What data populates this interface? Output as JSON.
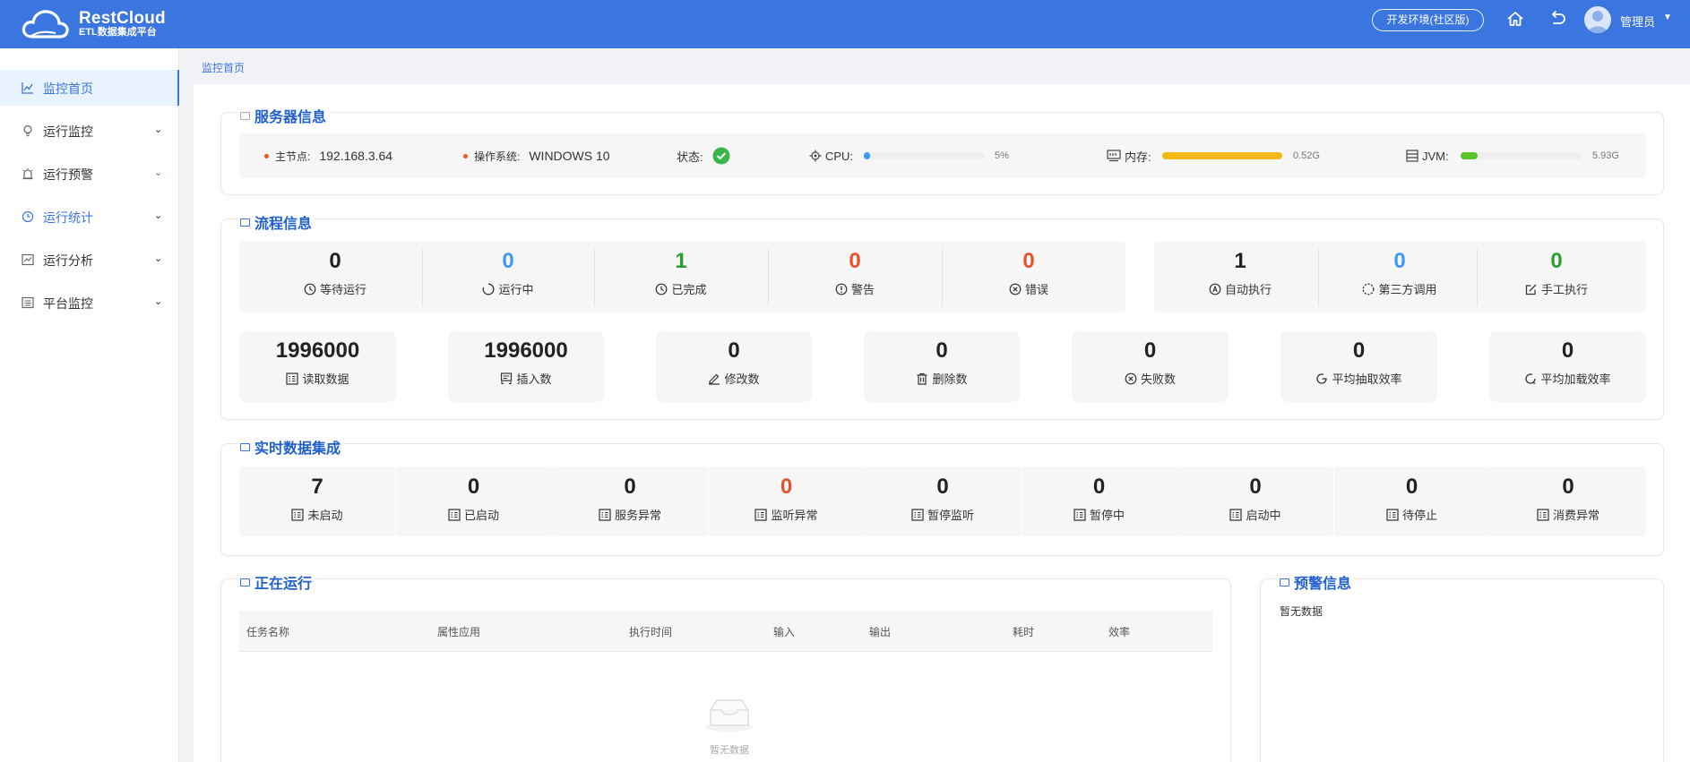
{
  "header": {
    "logo_name": "RestCloud",
    "logo_sub": "ETL数据集成平台",
    "env_label": "开发环境(社区版)",
    "user_name": "管理员"
  },
  "sidebar": {
    "items": [
      {
        "label": "监控首页",
        "icon": "chart-line-icon",
        "active": true
      },
      {
        "label": "运行监控",
        "icon": "bulb-icon"
      },
      {
        "label": "运行预警",
        "icon": "alarm-icon"
      },
      {
        "label": "运行统计",
        "icon": "clock-icon"
      },
      {
        "label": "运行分析",
        "icon": "analysis-icon"
      },
      {
        "label": "平台监控",
        "icon": "monitor-icon"
      }
    ]
  },
  "breadcrumb": "监控首页",
  "server": {
    "title": "服务器信息",
    "master_label": "主节点:",
    "master_value": "192.168.3.64",
    "os_label": "操作系统:",
    "os_value": "WINDOWS 10",
    "status_label": "状态:",
    "cpu_label": "CPU:",
    "cpu_value": "5%",
    "cpu_fraction": 0.05,
    "mem_label": "内存:",
    "mem_value": "0.52G",
    "mem_fraction": 1.0,
    "jvm_label": "JVM:",
    "jvm_value": "5.93G",
    "jvm_fraction": 0.14,
    "colors": {
      "cpu": "#3d9af5",
      "mem": "#f5b915",
      "jvm": "#58c62a"
    }
  },
  "flow": {
    "title": "流程信息",
    "status": [
      {
        "value": "0",
        "label": "等待运行",
        "icon": "clock-icon"
      },
      {
        "value": "0",
        "label": "运行中",
        "icon": "loading-icon"
      },
      {
        "value": "1",
        "label": "已完成",
        "icon": "clock-icon"
      },
      {
        "value": "0",
        "label": "警告",
        "icon": "warning-icon"
      },
      {
        "value": "0",
        "label": "错误",
        "icon": "error-icon"
      }
    ],
    "modes": [
      {
        "value": "1",
        "label": "自动执行",
        "icon": "auto-icon"
      },
      {
        "value": "0",
        "label": "第三方调用",
        "icon": "spinner-icon"
      },
      {
        "value": "0",
        "label": "手工执行",
        "icon": "edit-icon"
      }
    ],
    "cards": [
      {
        "value": "1996000",
        "label": "读取数据",
        "icon": "list-icon"
      },
      {
        "value": "1996000",
        "label": "插入数",
        "icon": "insert-icon"
      },
      {
        "value": "0",
        "label": "修改数",
        "icon": "pen-icon"
      },
      {
        "value": "0",
        "label": "删除数",
        "icon": "trash-icon"
      },
      {
        "value": "0",
        "label": "失败数",
        "icon": "error-icon"
      },
      {
        "value": "0",
        "label": "平均抽取效率",
        "icon": "refresh-icon"
      },
      {
        "value": "0",
        "label": "平均加载效率",
        "icon": "refresh-icon"
      }
    ]
  },
  "realtime": {
    "title": "实时数据集成",
    "items": [
      {
        "value": "7",
        "label": "未启动"
      },
      {
        "value": "0",
        "label": "已启动"
      },
      {
        "value": "0",
        "label": "服务异常"
      },
      {
        "value": "0",
        "label": "监听异常"
      },
      {
        "value": "0",
        "label": "暂停监听"
      },
      {
        "value": "0",
        "label": "暂停中"
      },
      {
        "value": "0",
        "label": "启动中"
      },
      {
        "value": "0",
        "label": "待停止"
      },
      {
        "value": "0",
        "label": "消费异常"
      }
    ]
  },
  "running": {
    "title": "正在运行",
    "columns": [
      "任务名称",
      "属性应用",
      "执行时间",
      "输入",
      "输出",
      "耗时",
      "效率"
    ],
    "empty_text": "暂无数据"
  },
  "warning": {
    "title": "预警信息",
    "empty_text": "暂无数据"
  }
}
